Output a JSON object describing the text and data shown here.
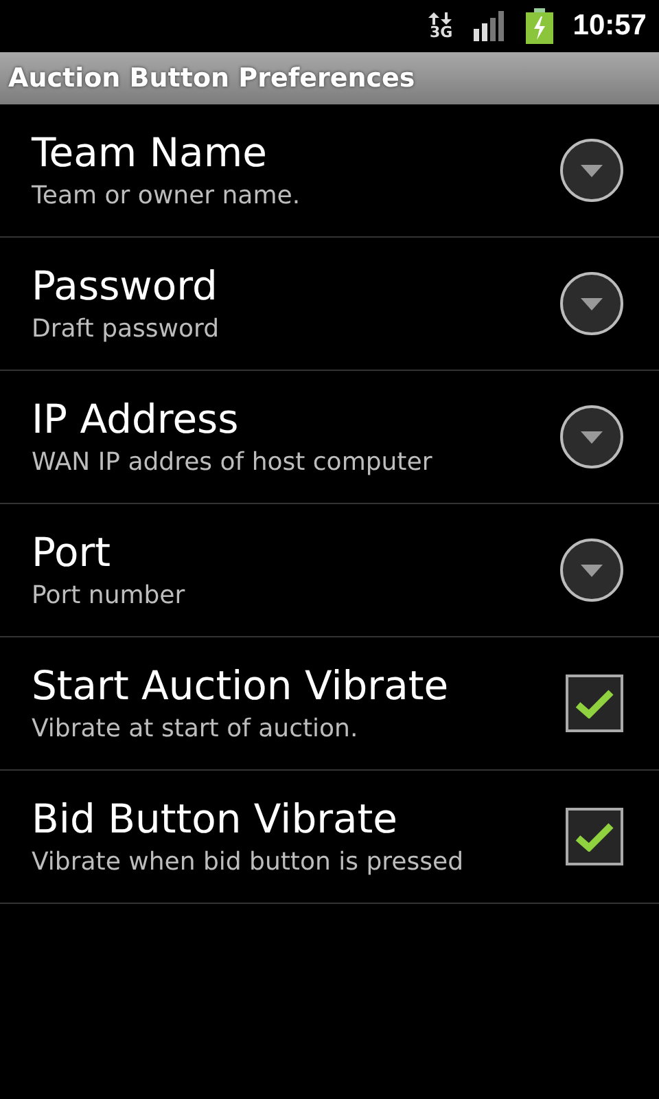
{
  "status_bar": {
    "network": "3G",
    "time": "10:57"
  },
  "window": {
    "title": "Auction Button Preferences"
  },
  "preferences": [
    {
      "kind": "dialog",
      "title": "Team Name",
      "summary": "Team or owner name."
    },
    {
      "kind": "dialog",
      "title": "Password",
      "summary": "Draft password"
    },
    {
      "kind": "dialog",
      "title": "IP Address",
      "summary": "WAN IP addres of host computer"
    },
    {
      "kind": "dialog",
      "title": "Port",
      "summary": "Port number"
    },
    {
      "kind": "checkbox",
      "title": "Start Auction Vibrate",
      "summary": "Vibrate at start of auction.",
      "checked": true
    },
    {
      "kind": "checkbox",
      "title": "Bid Button Vibrate",
      "summary": "Vibrate when bid button is pressed",
      "checked": true
    }
  ]
}
